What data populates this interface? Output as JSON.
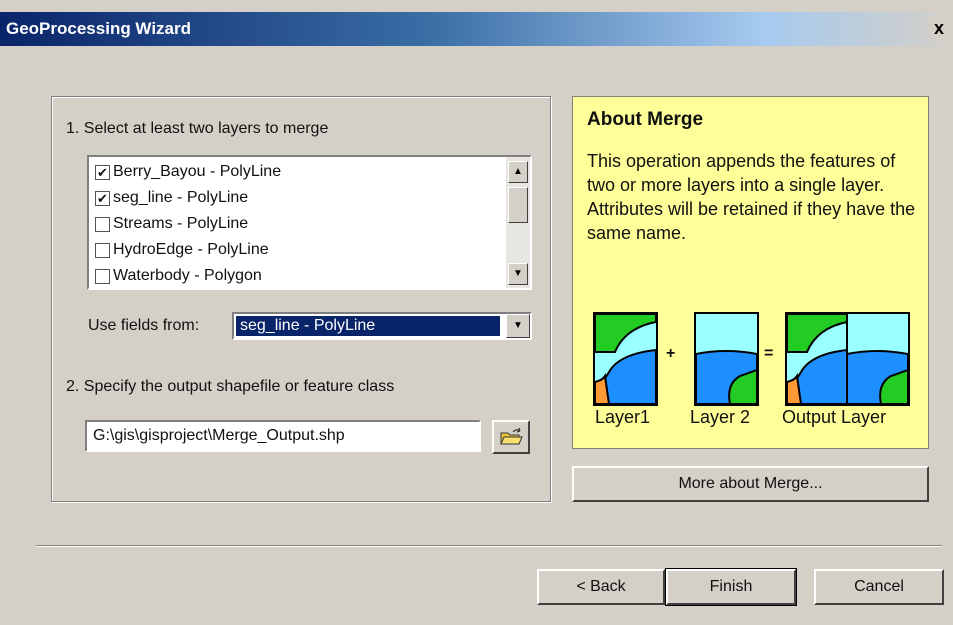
{
  "window": {
    "title": "GeoProcessing Wizard",
    "close_label": "x"
  },
  "step1": {
    "label": "1. Select at least two layers to merge",
    "layers": [
      {
        "label": "Berry_Bayou - PolyLine",
        "checked": true
      },
      {
        "label": "seg_line - PolyLine",
        "checked": true
      },
      {
        "label": "Streams - PolyLine",
        "checked": false
      },
      {
        "label": "HydroEdge - PolyLine",
        "checked": false
      },
      {
        "label": "Waterbody - Polygon",
        "checked": false
      }
    ],
    "use_fields_label": "Use fields from:",
    "use_fields_value": "seg_line - PolyLine"
  },
  "step2": {
    "label": "2. Specify the output shapefile or feature class",
    "output_path": "G:\\gis\\gisproject\\Merge_Output.shp"
  },
  "about": {
    "title": "About Merge",
    "body": "This operation appends the features of two or more layers into a single layer.  Attributes will be retained if they have the same name.",
    "plus": "+",
    "equals": "=",
    "captions": [
      "Layer1",
      "Layer 2",
      "Output Layer"
    ],
    "more_button": "More about Merge..."
  },
  "footer": {
    "back": "< Back",
    "finish": "Finish",
    "cancel": "Cancel"
  },
  "colors": {
    "green": "#22cc22",
    "cyan": "#99ffff",
    "blue": "#1e8fff",
    "orange": "#ff9933",
    "panel": "#ffff99",
    "selection": "#0a246a"
  }
}
